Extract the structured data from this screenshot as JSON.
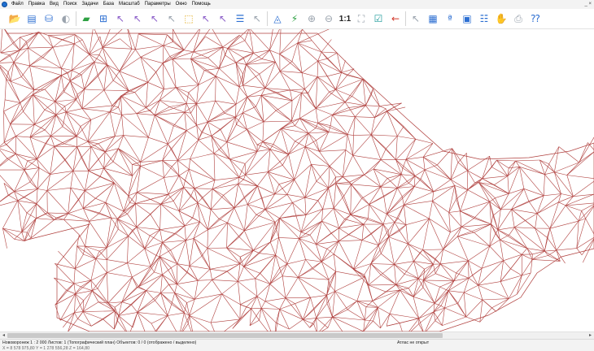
{
  "menu": {
    "items": [
      "Файл",
      "Правка",
      "Вид",
      "Поиск",
      "Задачи",
      "База",
      "Масштаб",
      "Параметры",
      "Окно",
      "Помощь"
    ],
    "window_controls": "_ ×"
  },
  "toolbar": {
    "zoom_one_to_one_label": "1:1",
    "icons": {
      "open": "open-folder-icon",
      "layers": "layers-icon",
      "db_connect": "database-icon",
      "zoom_in": "zoom-in-icon",
      "zoom_out": "zoom-out-icon",
      "zoom_one_to_one": "zoom-1-1-icon",
      "zoom_all": "zoom-extents-icon",
      "check": "checkmark-icon",
      "help": "help-cursor-icon"
    }
  },
  "map": {
    "description_color": "#b0403e",
    "background": "#ffffff"
  },
  "status": {
    "line1": "Нововоронеж   1 : 2 000   Листов: 1   (Топографический план)   Объектов: 0 / 0 (отображено / выделено)",
    "right": "Атлас не открыт",
    "line2": "X = 8 578 975,80   Y = 1 278 556,28   Z = 164,80"
  },
  "colors": {
    "mesh": "#b0403e",
    "menubar": "#f3f3f3",
    "statusbar": "#f3f3f3"
  }
}
